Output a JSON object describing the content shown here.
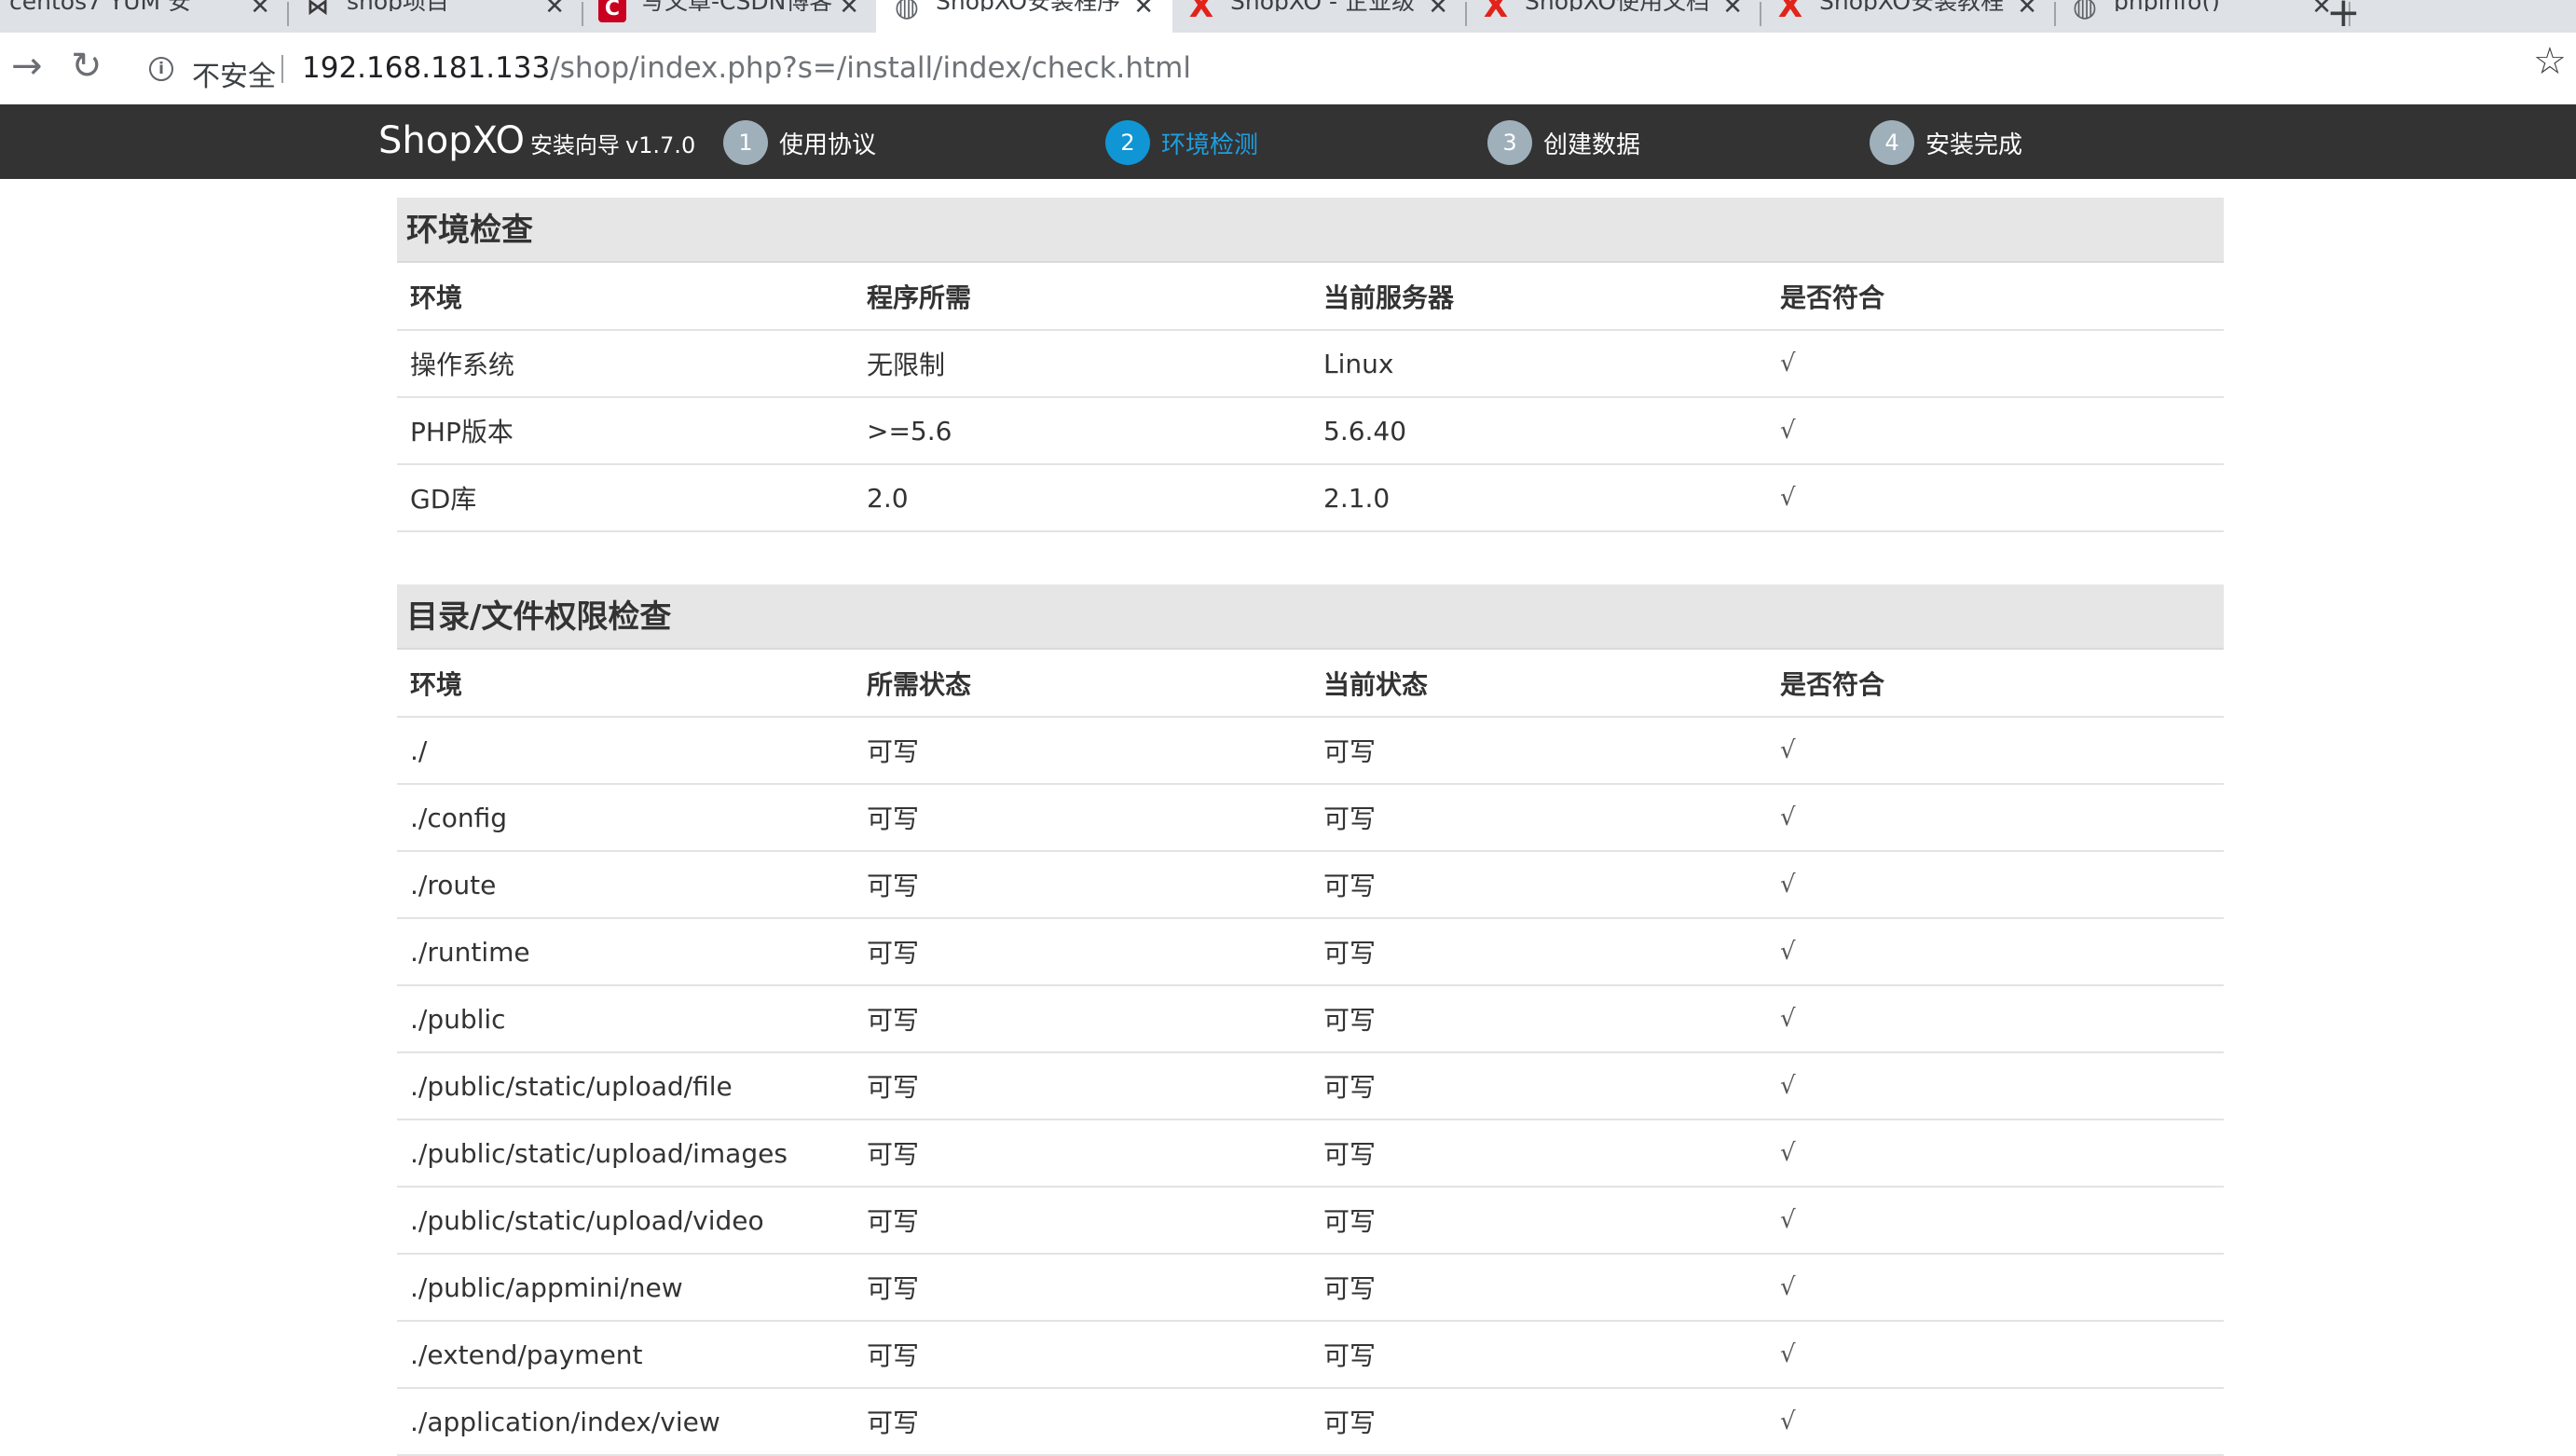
{
  "browser": {
    "tabs": [
      {
        "title": "centos7 YUM 安",
        "icon": "none",
        "active": false
      },
      {
        "title": "shop项目",
        "icon": "github",
        "active": false
      },
      {
        "title": "写文章-CSDN博客",
        "icon": "csdn",
        "active": false
      },
      {
        "title": "ShopXO安装程序",
        "icon": "globe",
        "active": true
      },
      {
        "title": "ShopXO - 企业级",
        "icon": "shopxo",
        "active": false
      },
      {
        "title": "ShopXO使用文档",
        "icon": "shopxo",
        "active": false
      },
      {
        "title": "ShopXO安装教程",
        "icon": "shopxo",
        "active": false
      },
      {
        "title": "phpinfo()",
        "icon": "globe",
        "active": false
      }
    ],
    "security_label": "不安全",
    "url_host": "192.168.181.133",
    "url_path": "/shop/index.php?s=/install/index/check.html"
  },
  "header": {
    "logo": "ShopXO",
    "subtitle": "安装向导",
    "version": "v1.7.0",
    "steps": [
      {
        "num": "1",
        "label": "使用协议"
      },
      {
        "num": "2",
        "label": "环境检测"
      },
      {
        "num": "3",
        "label": "创建数据"
      },
      {
        "num": "4",
        "label": "安装完成"
      }
    ],
    "current_step": 2,
    "accent_color": "#1096d4"
  },
  "env_check": {
    "title": "环境检查",
    "columns": [
      "环境",
      "程序所需",
      "当前服务器",
      "是否符合"
    ],
    "rows": [
      [
        "操作系统",
        "无限制",
        "Linux",
        "√"
      ],
      [
        "PHP版本",
        ">=5.6",
        "5.6.40",
        "√"
      ],
      [
        "GD库",
        "2.0",
        "2.1.0",
        "√"
      ]
    ]
  },
  "perm_check": {
    "title": "目录/文件权限检查",
    "columns": [
      "环境",
      "所需状态",
      "当前状态",
      "是否符合"
    ],
    "rows": [
      [
        "./",
        "可写",
        "可写",
        "√"
      ],
      [
        "./config",
        "可写",
        "可写",
        "√"
      ],
      [
        "./route",
        "可写",
        "可写",
        "√"
      ],
      [
        "./runtime",
        "可写",
        "可写",
        "√"
      ],
      [
        "./public",
        "可写",
        "可写",
        "√"
      ],
      [
        "./public/static/upload/file",
        "可写",
        "可写",
        "√"
      ],
      [
        "./public/static/upload/images",
        "可写",
        "可写",
        "√"
      ],
      [
        "./public/static/upload/video",
        "可写",
        "可写",
        "√"
      ],
      [
        "./public/appmini/new",
        "可写",
        "可写",
        "√"
      ],
      [
        "./extend/payment",
        "可写",
        "可写",
        "√"
      ],
      [
        "./application/index/view",
        "可写",
        "可写",
        "√"
      ]
    ]
  }
}
